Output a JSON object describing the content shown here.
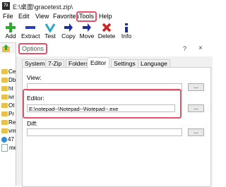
{
  "window": {
    "title": "E:\\桌面\\gracetest.zip\\",
    "app_icon": "7z"
  },
  "menu": [
    "File",
    "Edit",
    "View",
    "Favorites",
    "Tools",
    "Help"
  ],
  "toolbar": [
    {
      "label": "Add",
      "icon": "plus-icon",
      "color": "#2eaa2e"
    },
    {
      "label": "Extract",
      "icon": "minus-icon",
      "color": "#2a3fbf"
    },
    {
      "label": "Test",
      "icon": "check-icon",
      "color": "#2aa6c8"
    },
    {
      "label": "Copy",
      "icon": "copy-arrow-icon",
      "color": "#1f2d9a"
    },
    {
      "label": "Move",
      "icon": "move-arrow-icon",
      "color": "#1f2d9a"
    },
    {
      "label": "Delete",
      "icon": "delete-x-icon",
      "color": "#d02020"
    },
    {
      "label": "Info",
      "icon": "info-icon",
      "color": "#1f2d9a"
    }
  ],
  "folders": [
    {
      "name": "Ce",
      "type": "folder"
    },
    {
      "name": "Db",
      "type": "folder"
    },
    {
      "name": "ht",
      "type": "folder"
    },
    {
      "name": "ivr",
      "type": "folder"
    },
    {
      "name": "Ot",
      "type": "folder"
    },
    {
      "name": "Pr",
      "type": "folder"
    },
    {
      "name": "Re",
      "type": "folder"
    },
    {
      "name": "vm",
      "type": "folder"
    },
    {
      "name": "47",
      "type": "edge"
    },
    {
      "name": "me",
      "type": "file"
    }
  ],
  "dialog": {
    "title": "Options",
    "help": "?",
    "close": "×",
    "tabs": [
      "System",
      "7-Zip",
      "Folders",
      "Editor",
      "Settings",
      "Language"
    ],
    "active_tab": "Editor",
    "fields": {
      "view_label": "View:",
      "view_value": "",
      "editor_label": "Editor:",
      "editor_value": "E:\\notepad--\\Notepad--\\Notepad--.exe",
      "diff_label": "Diff:",
      "diff_value": "",
      "browse": "..."
    }
  },
  "highlight_color": "#e8506a"
}
